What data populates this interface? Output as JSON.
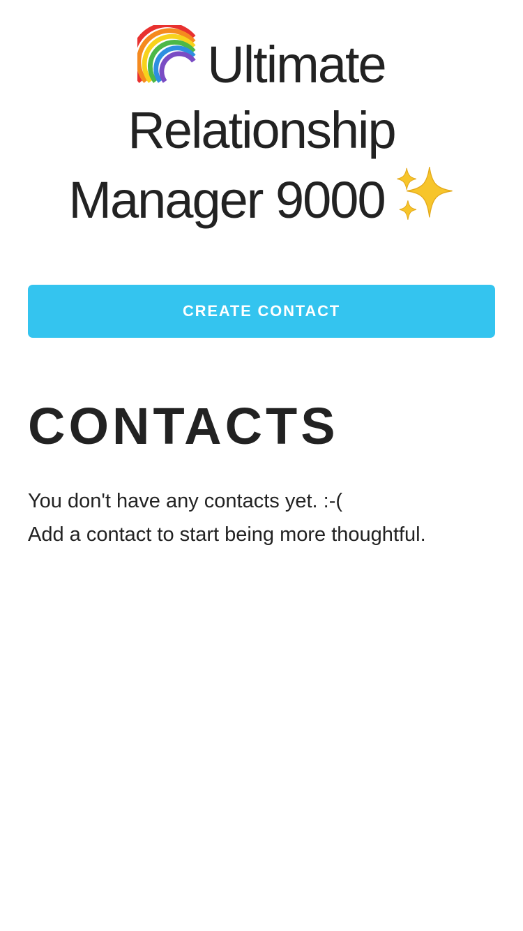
{
  "header": {
    "title_line_1": "Ultimate",
    "title_line_2": "Relationship",
    "title_line_3": "Manager 9000",
    "leading_icon": "rainbow-icon",
    "trailing_icon": "sparkles-icon"
  },
  "actions": {
    "create_contact_label": "CREATE CONTACT",
    "accent_color": "#34c4ef"
  },
  "contacts": {
    "heading": "CONTACTS",
    "empty_line_1": "You don't have any contacts yet. :-(",
    "empty_line_2": "Add a contact to start being more thoughtful."
  }
}
